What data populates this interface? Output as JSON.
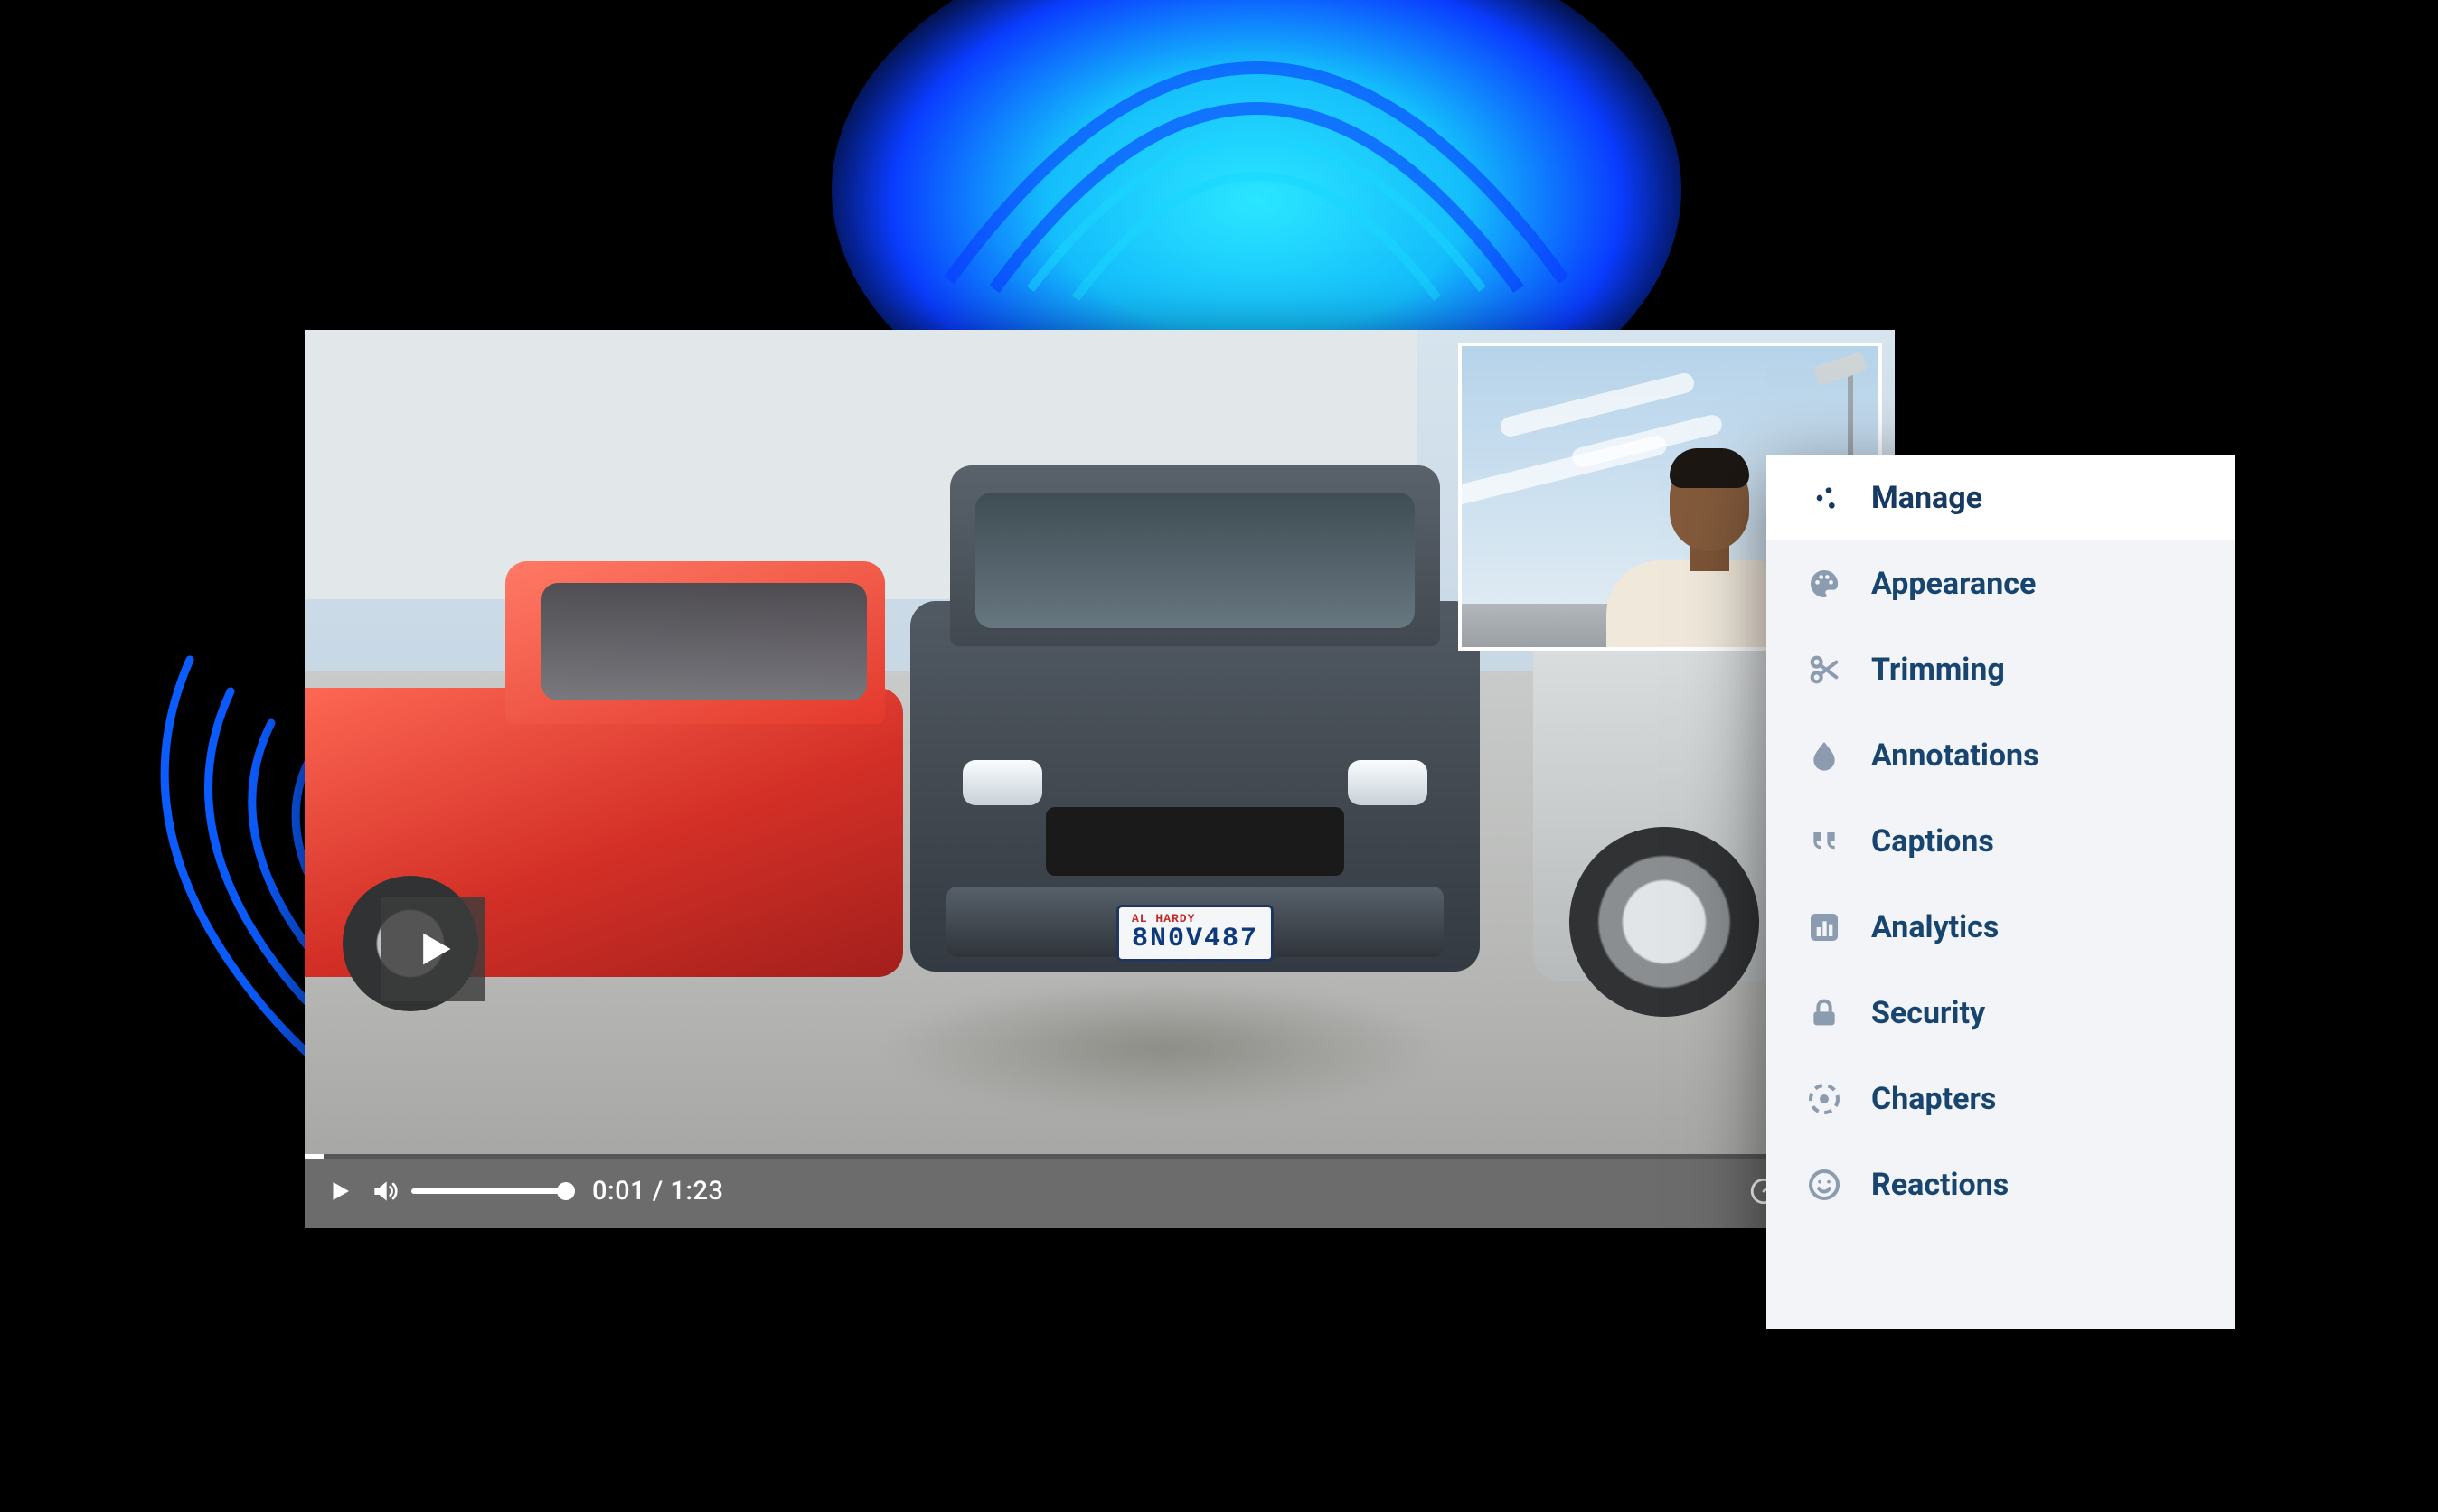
{
  "glow_color_outer": "#0a3cff",
  "glow_color_inner": "#19d7ff",
  "ring_color": "#0b5cff",
  "video": {
    "plate_dealer": "AL HARDY",
    "plate": "8N0V487",
    "current_time": "0:01",
    "duration": "1:23",
    "progress_pct": 1.2,
    "volume_pct": 100
  },
  "panel": {
    "items": [
      {
        "key": "manage",
        "label": "Manage",
        "active": true
      },
      {
        "key": "appearance",
        "label": "Appearance"
      },
      {
        "key": "trimming",
        "label": "Trimming"
      },
      {
        "key": "annotations",
        "label": "Annotations"
      },
      {
        "key": "captions",
        "label": "Captions"
      },
      {
        "key": "analytics",
        "label": "Analytics"
      },
      {
        "key": "security",
        "label": "Security"
      },
      {
        "key": "chapters",
        "label": "Chapters"
      },
      {
        "key": "reactions",
        "label": "Reactions"
      }
    ]
  }
}
